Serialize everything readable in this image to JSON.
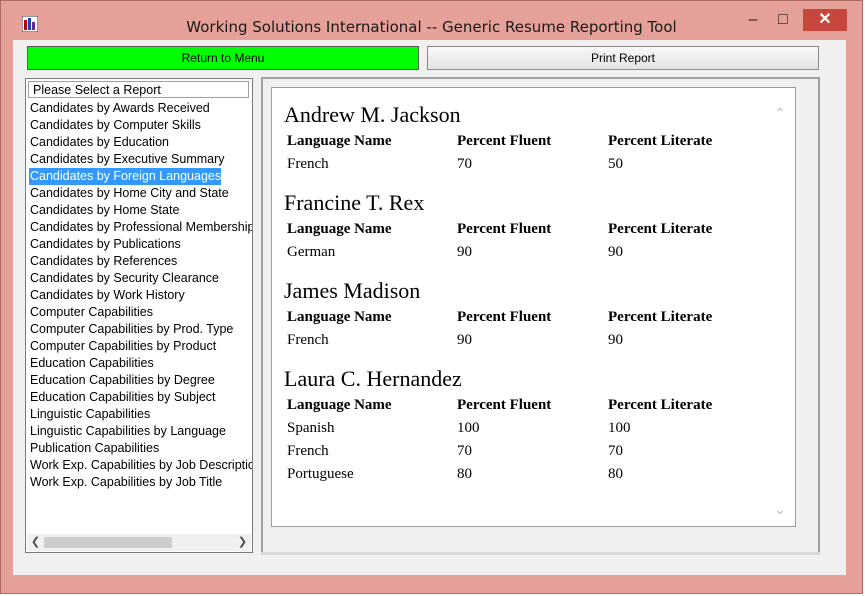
{
  "window": {
    "title": "Working Solutions International  --  Generic Resume Reporting Tool",
    "controls": {
      "minimize": "–",
      "maximize": "□",
      "close": "✕"
    }
  },
  "toolbar": {
    "return_label": "Return to Menu",
    "print_label": "Print Report"
  },
  "report_list": {
    "header": "Please Select a Report",
    "items": [
      "Candidates by Awards Received",
      "Candidates by Computer Skills",
      "Candidates by Education",
      "Candidates by Executive Summary",
      "Candidates by Foreign Languages",
      "Candidates by Home City and State",
      "Candidates by Home State",
      "Candidates by Professional Membership",
      "Candidates by Publications",
      "Candidates by References",
      "Candidates by Security Clearance",
      "Candidates by Work History",
      "Computer Capabilities",
      "Computer Capabilities by Prod. Type",
      "Computer Capabilities by Product",
      "Education Capabilities",
      "Education Capabilities by Degree",
      "Education Capabilities by Subject",
      "Linguistic Capabilities",
      "Linguistic Capabilities by Language",
      "Publication Capabilities",
      "Work Exp. Capabilities by Job Description",
      "Work Exp. Capabilities by Job Title"
    ],
    "selected_index": 4
  },
  "report": {
    "columns": [
      "Language Name",
      "Percent Fluent",
      "Percent Literate"
    ],
    "candidates": [
      {
        "name": "Andrew M. Jackson",
        "rows": [
          [
            "French",
            "70",
            "50"
          ]
        ]
      },
      {
        "name": "Francine T. Rex",
        "rows": [
          [
            "German",
            "90",
            "90"
          ]
        ]
      },
      {
        "name": "James Madison",
        "rows": [
          [
            "French",
            "90",
            "90"
          ]
        ]
      },
      {
        "name": "Laura C. Hernandez",
        "rows": [
          [
            "Spanish",
            "100",
            "100"
          ],
          [
            "French",
            "70",
            "70"
          ],
          [
            "Portuguese",
            "80",
            "80"
          ]
        ]
      }
    ]
  },
  "colors": {
    "window_frame": "#e6a09a",
    "return_button": "#00ff00",
    "selection": "#3399ff",
    "close_button": "#c7473c"
  },
  "icons": [
    "app-icon",
    "scroll-left-icon",
    "scroll-right-icon",
    "scroll-up-icon",
    "scroll-down-icon"
  ]
}
